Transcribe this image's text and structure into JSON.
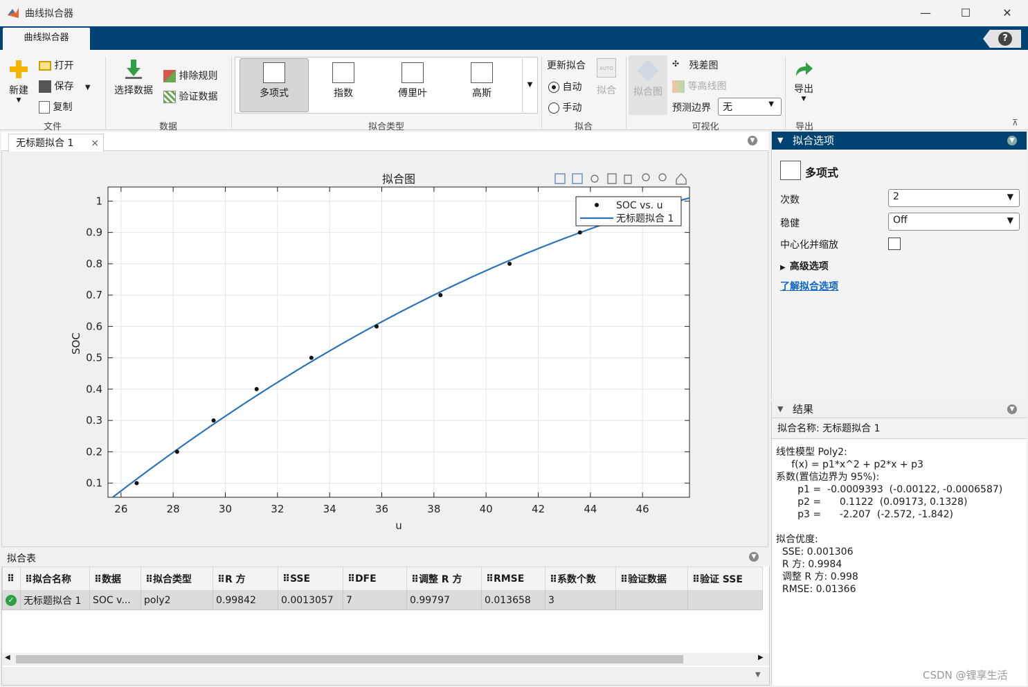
{
  "window": {
    "title": "曲线拟合器",
    "minimize": "—",
    "maximize": "☐",
    "close": "✕"
  },
  "app_tab": "曲线拟合器",
  "help": "?",
  "ribbon": {
    "file": {
      "new": "新建",
      "open": "打开",
      "save": "保存",
      "copy": "复制",
      "group": "文件"
    },
    "data": {
      "select": "选择数据",
      "exclude": "排除规则",
      "validate": "验证数据",
      "group": "数据"
    },
    "fit_types": {
      "items": [
        "多项式",
        "指数",
        "傅里叶",
        "高斯"
      ],
      "group": "拟合类型"
    },
    "fit": {
      "update": "更新拟合",
      "auto": "自动",
      "manual": "手动",
      "fit_btn": "拟合",
      "group": "拟合"
    },
    "visual": {
      "plot": "拟合图",
      "residual": "残差图",
      "contour": "等高线图",
      "bounds_label": "预测边界",
      "bounds_value": "无",
      "group": "可视化"
    },
    "export": {
      "label": "导出",
      "group": "导出"
    }
  },
  "doc_tab": {
    "label": "无标题拟合 1",
    "close": "×"
  },
  "chart_data": {
    "type": "scatter",
    "title": "拟合图",
    "xlabel": "u",
    "ylabel": "SOC",
    "xlim": [
      25.5,
      47.8
    ],
    "ylim": [
      0.055,
      1.045
    ],
    "xticks": [
      26,
      28,
      30,
      32,
      34,
      36,
      38,
      40,
      42,
      44,
      46
    ],
    "yticks": [
      0.1,
      0.2,
      0.3,
      0.4,
      0.5,
      0.6,
      0.7,
      0.8,
      0.9,
      1
    ],
    "grid": true,
    "legend_position": "top-right",
    "series": [
      {
        "name": "SOC vs. u",
        "x": [
          26.6,
          28.15,
          29.55,
          31.2,
          33.3,
          35.8,
          38.25,
          40.9,
          43.6,
          47.4
        ],
        "y": [
          0.1,
          0.2,
          0.3,
          0.4,
          0.5,
          0.6,
          0.7,
          0.8,
          0.9,
          1.0
        ]
      },
      {
        "name": "无标题拟合 1",
        "coefficients": [
          -0.0009393,
          0.1122,
          -2.207
        ]
      }
    ]
  },
  "table": {
    "title": "拟合表",
    "headers": [
      "拟合名称",
      "数据",
      "拟合类型",
      "R 方",
      "SSE",
      "DFE",
      "调整 R 方",
      "RMSE",
      "系数个数",
      "验证数据",
      "验证 SSE"
    ],
    "rows": [
      [
        "无标题拟合 1",
        "SOC v...",
        "poly2",
        "0.99842",
        "0.0013057",
        "7",
        "0.99797",
        "0.013658",
        "3",
        "",
        ""
      ]
    ]
  },
  "options": {
    "title": "拟合选项",
    "model": "多项式",
    "degree_label": "次数",
    "degree_value": "2",
    "robust_label": "稳健",
    "robust_value": "Off",
    "center_label": "中心化并缩放",
    "advanced": "高级选项",
    "learn": "了解拟合选项"
  },
  "results": {
    "title": "结果",
    "fit_name": "拟合名称: 无标题拟合 1",
    "text": "线性模型 Poly2:\n     f(x) = p1*x^2 + p2*x + p3\n系数(置信边界为 95%):\n       p1 =  -0.0009393  (-0.00122, -0.0006587)\n       p2 =      0.1122  (0.09173, 0.1328)\n       p3 =      -2.207  (-2.572, -1.842)\n\n拟合优度:\n  SSE: 0.001306\n  R 方: 0.9984\n  调整 R 方: 0.998\n  RMSE: 0.01366"
  },
  "watermark": "CSDN @锂享生活"
}
